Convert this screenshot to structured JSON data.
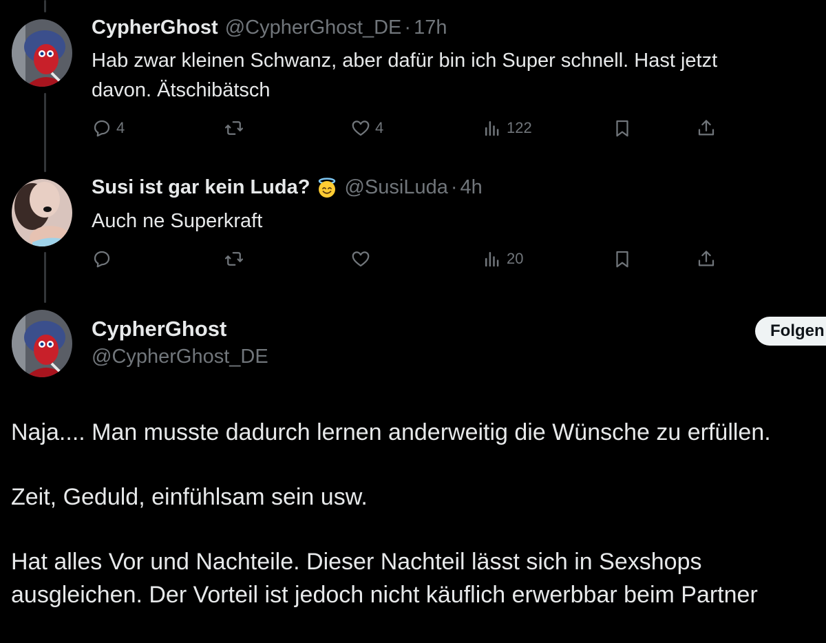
{
  "replies": [
    {
      "name": "CypherGhost",
      "handle": "@CypherGhost_DE",
      "separator": "·",
      "time": "17h",
      "text_lines": [
        "Hab zwar kleinen Schwanz, aber dafür bin ich Super schnell. Hast jetzt",
        "davon. Ätschibätsch"
      ],
      "replies_count": "4",
      "likes_count": "4",
      "views_count": "122"
    },
    {
      "name": "Susi ist gar kein Luda?",
      "handle": "@SusiLuda",
      "separator": "·",
      "time": "4h",
      "text_lines": [
        "Auch ne Superkraft"
      ],
      "replies_count": "",
      "likes_count": "",
      "views_count": "20"
    }
  ],
  "main_tweet": {
    "name": "CypherGhost",
    "handle": "@CypherGhost_DE",
    "follow_label": "Folgen",
    "paragraphs": [
      "Naja.... Man musste dadurch lernen anderweitig die Wünsche zu erfüllen.",
      "Zeit, Geduld, einfühlsam sein usw.",
      "Hat alles Vor und Nachteile. Dieser Nachteil lässt sich in Sexshops ausgleichen. Der Vorteil ist jedoch nicht käuflich erwerbbar beim Partner"
    ]
  },
  "icons": {
    "reply": "reply-icon",
    "retweet": "retweet-icon",
    "like": "heart-icon",
    "views": "views-icon",
    "bookmark": "bookmark-icon",
    "share": "share-icon",
    "emoji": "smiling-face-with-halo-emoji"
  },
  "colors": {
    "background": "#000000",
    "text": "#e7e9ea",
    "muted": "#71767b",
    "follow_bg": "#eff3f4"
  }
}
